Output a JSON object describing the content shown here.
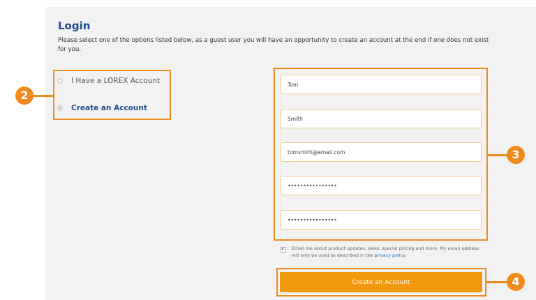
{
  "login": {
    "title": "Login",
    "intro": "Please select one of the options listed below, as a guest user you will have an opportunity to create an account at the end if one does not exist for you."
  },
  "options": [
    {
      "label": "I Have a LOREX Account",
      "selected": false
    },
    {
      "label": "Create an Account",
      "selected": true
    }
  ],
  "form": {
    "first_name": "Tom",
    "last_name": "Smith",
    "email": "tomsmith@email.com",
    "password": "••••••••••••••••",
    "confirm_password": "••••••••••••••••",
    "consent_text": "Email me about product updates, sales, special pricing and more. My email address will only be used as described in the",
    "consent_link": "privacy policy.",
    "submit_label": "Create an Account"
  },
  "callouts": {
    "two": "2",
    "three": "3",
    "four": "4"
  },
  "colors": {
    "accent": "#ef8a1c",
    "title": "#1f4e8c",
    "button": "#f2980f"
  }
}
